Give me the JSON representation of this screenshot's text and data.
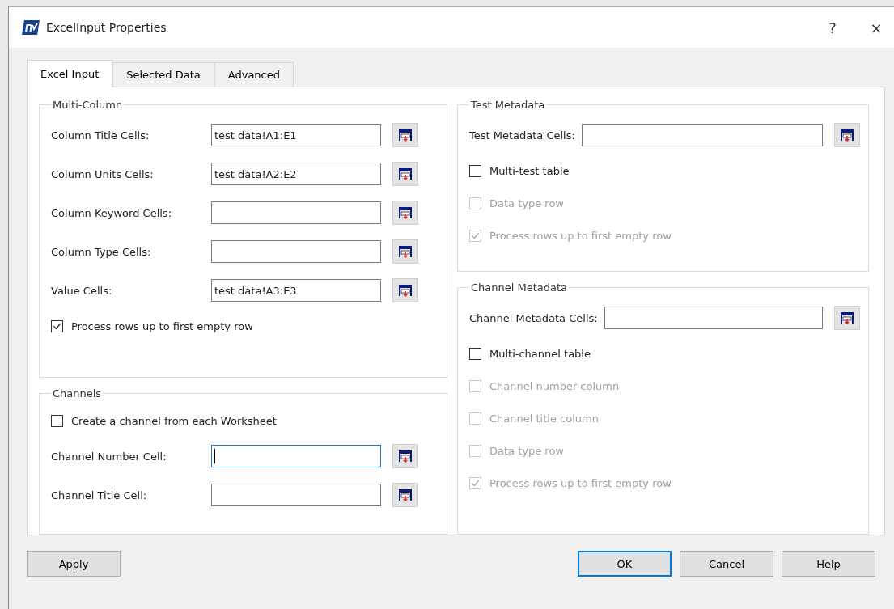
{
  "window": {
    "title": "ExcelInput Properties",
    "help": "?",
    "close": "×"
  },
  "tabs": [
    {
      "label": "Excel Input",
      "selected": true
    },
    {
      "label": "Selected Data",
      "selected": false
    },
    {
      "label": "Advanced",
      "selected": false
    }
  ],
  "columns": [
    [
      {
        "title": "Multi-Column",
        "items": [
          {
            "kind": "field",
            "label": "Column Title Cells:",
            "value": "test data!A1:E1",
            "focused": false
          },
          {
            "kind": "field",
            "label": "Column Units Cells:",
            "value": "test data!A2:E2",
            "focused": false
          },
          {
            "kind": "field",
            "label": "Column Keyword Cells:",
            "value": "",
            "focused": false
          },
          {
            "kind": "field",
            "label": "Column Type Cells:",
            "value": "",
            "focused": false
          },
          {
            "kind": "field",
            "label": "Value Cells:",
            "value": "test data!A3:E3",
            "focused": false
          },
          {
            "kind": "checkbox",
            "label": "Process rows up to first empty row",
            "checked": true,
            "disabled": false
          }
        ]
      },
      {
        "title": "Channels",
        "items": [
          {
            "kind": "checkbox",
            "label": "Create a channel from each Worksheet",
            "checked": false,
            "disabled": false
          },
          {
            "kind": "field",
            "label": "Channel Number Cell:",
            "value": "",
            "focused": true
          },
          {
            "kind": "field",
            "label": "Channel Title Cell:",
            "value": "",
            "focused": false
          }
        ]
      }
    ],
    [
      {
        "title": "Test Metadata",
        "items": [
          {
            "kind": "field",
            "label": "Test Metadata Cells:",
            "value": "",
            "focused": false
          },
          {
            "kind": "checkbox",
            "label": "Multi-test table",
            "checked": false,
            "disabled": false
          },
          {
            "kind": "checkbox",
            "label": "Data type row",
            "checked": false,
            "disabled": true
          },
          {
            "kind": "checkbox",
            "label": "Process rows up to first empty row",
            "checked": true,
            "disabled": true
          }
        ]
      },
      {
        "title": "Channel Metadata",
        "items": [
          {
            "kind": "field",
            "label": "Channel Metadata Cells:",
            "value": "",
            "focused": false
          },
          {
            "kind": "checkbox",
            "label": "Multi-channel table",
            "checked": false,
            "disabled": false
          },
          {
            "kind": "checkbox",
            "label": "Channel number column",
            "checked": false,
            "disabled": true
          },
          {
            "kind": "checkbox",
            "label": "Channel title column",
            "checked": false,
            "disabled": true
          },
          {
            "kind": "checkbox",
            "label": "Data type row",
            "checked": false,
            "disabled": true
          },
          {
            "kind": "checkbox",
            "label": "Process rows up to first empty row",
            "checked": true,
            "disabled": true
          }
        ]
      }
    ]
  ],
  "left_buttons": [
    {
      "label": "Apply",
      "default": false
    }
  ],
  "right_buttons": [
    {
      "label": "OK",
      "default": true
    },
    {
      "label": "Cancel",
      "default": false
    },
    {
      "label": "Help",
      "default": false
    }
  ]
}
